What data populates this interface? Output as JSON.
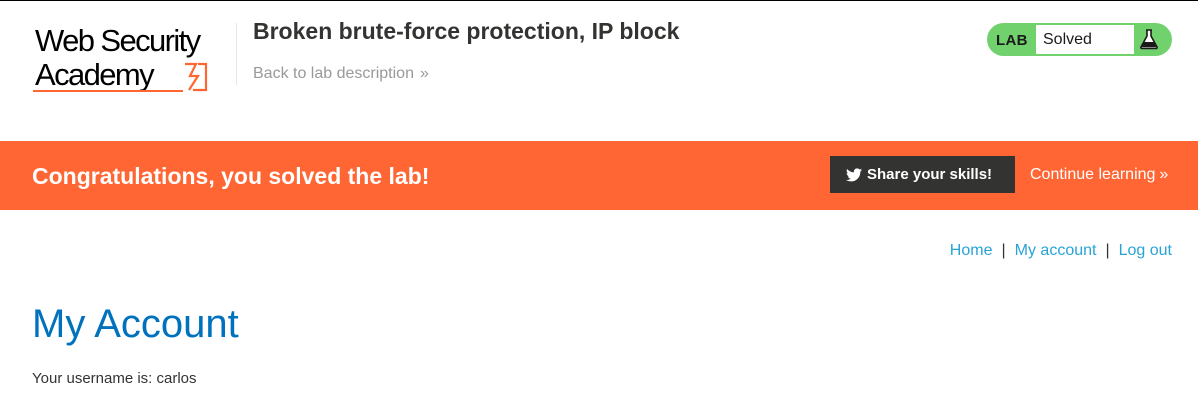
{
  "header": {
    "logo": {
      "line1": "Web Security",
      "line2": "Academy"
    },
    "lab_title": "Broken brute-force protection, IP block",
    "back_link": "Back to lab description",
    "lab_status": {
      "label": "LAB",
      "status": "Solved"
    }
  },
  "banner": {
    "message": "Congratulations, you solved the lab!",
    "share_button": "Share your skills!",
    "continue_link": "Continue learning"
  },
  "nav": {
    "home": "Home",
    "separator": "|",
    "my_account": "My account",
    "log_out": "Log out"
  },
  "main": {
    "title": "My Account",
    "username_text": "Your username is: carlos"
  },
  "icons": {
    "logo_mark": "academy-bolt-icon",
    "flask": "flask-icon",
    "twitter": "twitter-icon",
    "chevrons": "double-chevron-right-icon"
  },
  "colors": {
    "accent_orange": "#ff6633",
    "solved_green": "#70d16d",
    "link_blue": "#29a3d6",
    "title_blue": "#0071bc",
    "dark_button": "#333332"
  }
}
